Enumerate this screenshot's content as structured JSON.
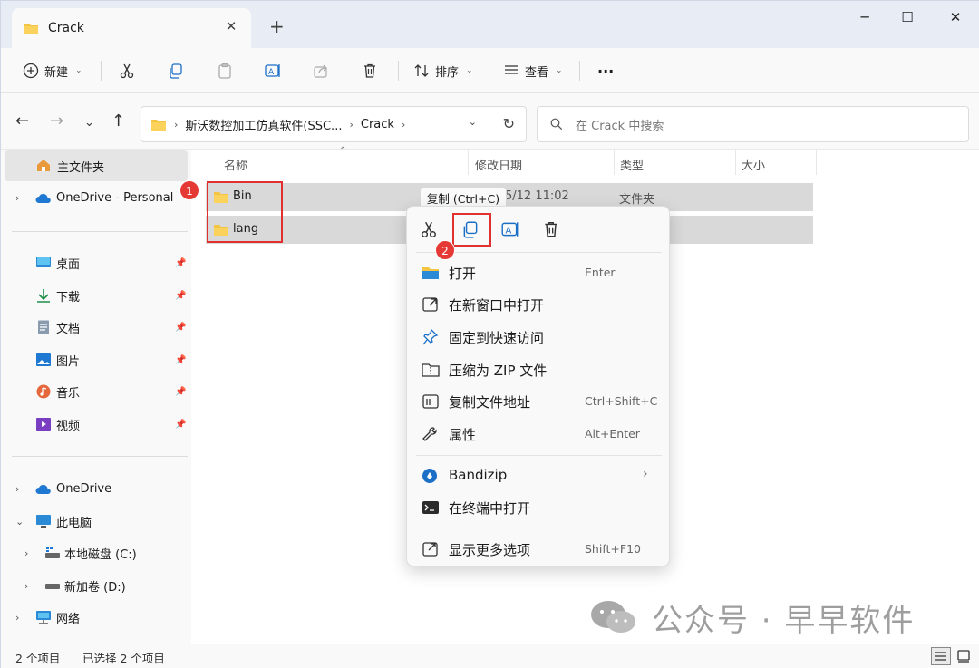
{
  "window": {
    "tab_title": "Crack",
    "new_tab": "+",
    "minimize": "─",
    "maximize": "☐",
    "close": "✕"
  },
  "toolbar": {
    "new_label": "新建",
    "sort_label": "排序",
    "view_label": "查看",
    "more_label": "···"
  },
  "address": {
    "crumbs": [
      "斯沃数控加工仿真软件(SSC...",
      "Crack"
    ],
    "search_placeholder": "在 Crack 中搜索"
  },
  "sidebar": {
    "home": "主文件夹",
    "onedrive_personal": "OneDrive - Personal",
    "quick": [
      {
        "label": "桌面",
        "icon": "desktop-icon"
      },
      {
        "label": "下载",
        "icon": "download-icon"
      },
      {
        "label": "文档",
        "icon": "document-icon"
      },
      {
        "label": "图片",
        "icon": "pictures-icon"
      },
      {
        "label": "音乐",
        "icon": "music-icon"
      },
      {
        "label": "视频",
        "icon": "video-icon"
      }
    ],
    "onedrive": "OneDrive",
    "this_pc": "此电脑",
    "drive_c": "本地磁盘 (C:)",
    "drive_d": "新加卷 (D:)",
    "network": "网络"
  },
  "columns": {
    "name": "名称",
    "modified": "修改日期",
    "type": "类型",
    "size": "大小"
  },
  "files": [
    {
      "name": "Bin",
      "modified": "5/12 11:02",
      "type": "文件夹"
    },
    {
      "name": "lang",
      "modified": "",
      "type": ""
    }
  ],
  "tooltip": "复制 (Ctrl+C)",
  "badges": {
    "one": "1",
    "two": "2"
  },
  "context_menu": {
    "items": [
      {
        "label": "打开",
        "key": "Enter",
        "icon": "folder-open-icon"
      },
      {
        "label": "在新窗口中打开",
        "key": "",
        "icon": "new-window-icon"
      },
      {
        "label": "固定到快速访问",
        "key": "",
        "icon": "pin-icon"
      },
      {
        "label": "压缩为 ZIP 文件",
        "key": "",
        "icon": "zip-icon"
      },
      {
        "label": "复制文件地址",
        "key": "Ctrl+Shift+C",
        "icon": "copy-path-icon"
      },
      {
        "label": "属性",
        "key": "Alt+Enter",
        "icon": "properties-icon"
      }
    ],
    "bandizip": "Bandizip",
    "terminal": "在终端中打开",
    "more": "显示更多选项",
    "more_key": "Shift+F10"
  },
  "status": {
    "count": "2 个项目",
    "selected": "已选择 2 个项目"
  },
  "watermark": "公众号 · 早早软件",
  "colors": {
    "folder": "#f4c542",
    "accent": "#0067c0",
    "red": "#e03030"
  }
}
